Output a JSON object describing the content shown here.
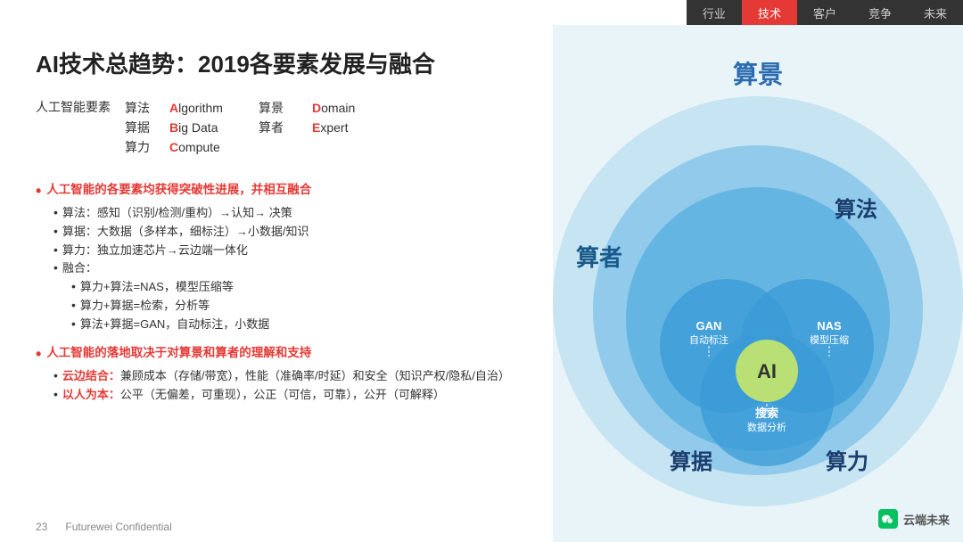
{
  "nav": {
    "items": [
      {
        "label": "行业",
        "active": false
      },
      {
        "label": "技术",
        "active": true
      },
      {
        "label": "客户",
        "active": false
      },
      {
        "label": "竞争",
        "active": false
      },
      {
        "label": "未来",
        "active": false
      }
    ]
  },
  "title": "AI技术总趋势：2019各要素发展与融合",
  "elements": {
    "label": "人工智能要素",
    "rows": [
      {
        "zh": "算法",
        "en_prefix": "A",
        "en_rest": "lgorithm",
        "zh2": "算景",
        "en2_prefix": "D",
        "en2_rest": "omain"
      },
      {
        "zh": "算据",
        "en_prefix": "B",
        "en_rest": "ig Data",
        "zh2": "算者",
        "en2_prefix": "E",
        "en2_rest": "xpert"
      },
      {
        "zh": "算力",
        "en_prefix": "C",
        "en_rest": "ompute",
        "zh2": "",
        "en2_prefix": "",
        "en2_rest": ""
      }
    ]
  },
  "section1": {
    "primary": "人工智能的各要素均获得突破性进展，并相互融合",
    "bullets": [
      "算法：感知（识别/检测/重构）→认知→ 决策",
      "算据：大数据（多样本，细标注）→小数据/知识",
      "算力：独立加速芯片→云边端一体化",
      "融合："
    ],
    "sub_bullets": [
      "算力+算法=NAS，模型压缩等",
      "算力+算据=检索，分析等",
      "算法+算据=GAN，自动标注，小数据"
    ]
  },
  "section2": {
    "primary": "人工智能的落地取决于对算景和算者的理解和支持",
    "bullets": [
      {
        "prefix": "云边结合：",
        "text": "兼顾成本（存储/带宽），性能（准确率/时延）和安全（知识产权/隐私/自治）"
      },
      {
        "prefix": "以人为本：",
        "text": "公平（无偏差，可重现），公正（可信，可靠），公开（可解释）"
      }
    ]
  },
  "footer": {
    "page_number": "23",
    "confidential": "Futurewei Confidential"
  },
  "diagram": {
    "outer_label": "算景",
    "ring2_label": "算者",
    "ring3_label": "算法",
    "bottom_left": "算据",
    "bottom_right": "算力",
    "center": "AI",
    "gan_label": "GAN",
    "gan_sub": "自动标注",
    "nas_label": "NAS",
    "nas_sub": "模型压缩",
    "search_label": "搜索",
    "search_sub": "数据分析"
  },
  "watermark": {
    "text": "云端未来"
  }
}
